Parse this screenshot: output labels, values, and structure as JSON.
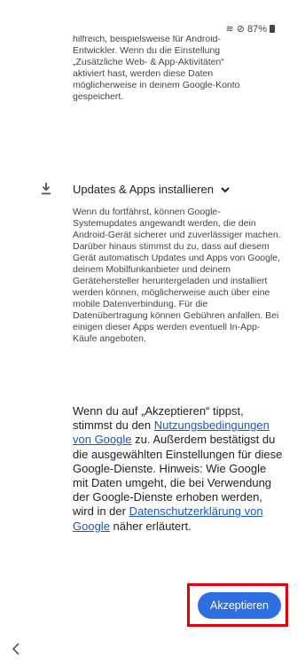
{
  "status": {
    "signal_icons": "wifi-off-do-not-disturb",
    "battery_percent": "87%"
  },
  "top_paragraph": "hilfreich, beispielsweise für Android-Entwickler. Wenn du die Einstellung „Zusätzliche Web- & App-Aktivitäten“ aktiviert hast, werden diese Daten möglicherweise in deinem Google-Konto gespeichert.",
  "updates": {
    "title": "Updates & Apps installieren",
    "description": "Wenn du fortfährst, können Google-Systemupdates angewandt werden, die dein Android-Gerät sicherer und zuverlässiger machen. Darüber hinaus stimmst du zu, dass auf diesem Gerät automatisch Updates und Apps von Google, deinem Mobilfunkanbieter und deinem Gerätehersteller heruntergeladen und installiert werden können, möglicherweise auch über eine mobile Datenverbindung. Für die Datenübertragung können Gebühren anfallen. Bei einigen dieser Apps werden eventuell In-App-Käufe angeboten."
  },
  "consent": {
    "part1": "Wenn du auf „Akzeptieren“ tippst, stimmst du den ",
    "link1": "Nutzungsbedingungen von Google",
    "part2": " zu. Außerdem bestätigst du die ausgewählten Einstellungen für diese Google-Dienste. Hinweis: Wie Google mit Daten umgeht, die bei Verwendung der Google-Dienste erhoben werden, wird in der ",
    "link2": "Datenschutzerklärung von Google",
    "part3": " näher erläutert."
  },
  "accept_button": "Akzeptieren",
  "colors": {
    "button": "#2f6fe4",
    "link": "#1a56c8",
    "highlight": "#e3000f"
  }
}
